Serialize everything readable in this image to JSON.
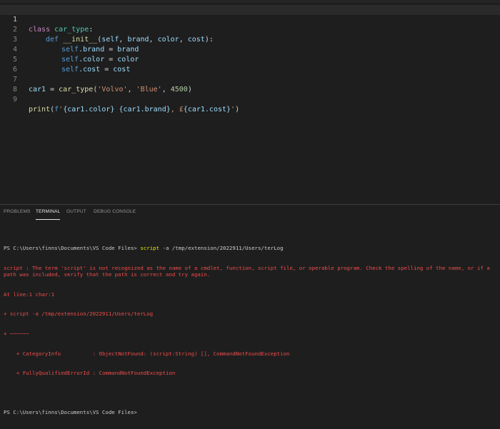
{
  "editor": {
    "lines": [
      {
        "n": "1",
        "active": true
      },
      {
        "n": "2"
      },
      {
        "n": "3"
      },
      {
        "n": "4"
      },
      {
        "n": "5"
      },
      {
        "n": "6"
      },
      {
        "n": "7"
      },
      {
        "n": "8"
      },
      {
        "n": "9"
      }
    ],
    "tokens": {
      "l1_kw": "class",
      "l1_name": "car_type",
      "l1_rest": ":",
      "l2_def": "def",
      "l2_fn": "__init__",
      "l2_open": "(",
      "l2_self": "self",
      "l2_c1": ", ",
      "l2_brand": "brand",
      "l2_c2": ", ",
      "l2_color": "color",
      "l2_c3": ", ",
      "l2_cost": "cost",
      "l2_close": "):",
      "l3_self": "self",
      "l3_attr": ".brand",
      "l3_eq": " = ",
      "l3_val": "brand",
      "l4_self": "self",
      "l4_attr": ".color",
      "l4_eq": " = ",
      "l4_val": "color",
      "l5_self": "self",
      "l5_attr": ".cost",
      "l5_eq": " = ",
      "l5_val": "cost",
      "l7_var": "car1",
      "l7_eq": " = ",
      "l7_cls": "car_type",
      "l7_open": "(",
      "l7_s1": "'Volvo'",
      "l7_c1": ", ",
      "l7_s2": "'Blue'",
      "l7_c2": ", ",
      "l7_n": "4500",
      "l7_close": ")",
      "l9_fn": "print",
      "l9_open": "(",
      "l9_f": "f",
      "l9_s1": "'",
      "l9_e1": "{car1.color}",
      "l9_s2": " ",
      "l9_e2": "{car1.brand}",
      "l9_s3": ", £",
      "l9_e3": "{car1.cost}",
      "l9_s4": "'",
      "l9_close": ")"
    }
  },
  "panel": {
    "tabs": [
      "PROBLEMS",
      "TERMINAL",
      "OUTPUT",
      "DEBUG CONSOLE"
    ],
    "active_tab": "TERMINAL"
  },
  "terminal": {
    "prompt1": "PS C:\\Users\\finns\\Documents\\VS Code Files> ",
    "cmd1": "script",
    "args1": " -a /tmp/extension/2022911/Users/terLog",
    "err1": "script : The term 'script' is not recognized as the name of a cmdlet, function, script file, or operable program. Check the spelling of the name, or if a path was included, verify that the path is correct and try again.",
    "err2": "At line:1 char:1",
    "err3": "+ script -a /tmp/extension/2022911/Users/terLog",
    "err4": "+ ~~~~~~",
    "err5": "    + CategoryInfo          : ObjectNotFound: (script:String) [], CommandNotFoundException",
    "err6": "    + FullyQualifiedErrorId : CommandNotFoundException",
    "prompt2": "PS C:\\Users\\finns\\Documents\\VS Code Files> "
  }
}
